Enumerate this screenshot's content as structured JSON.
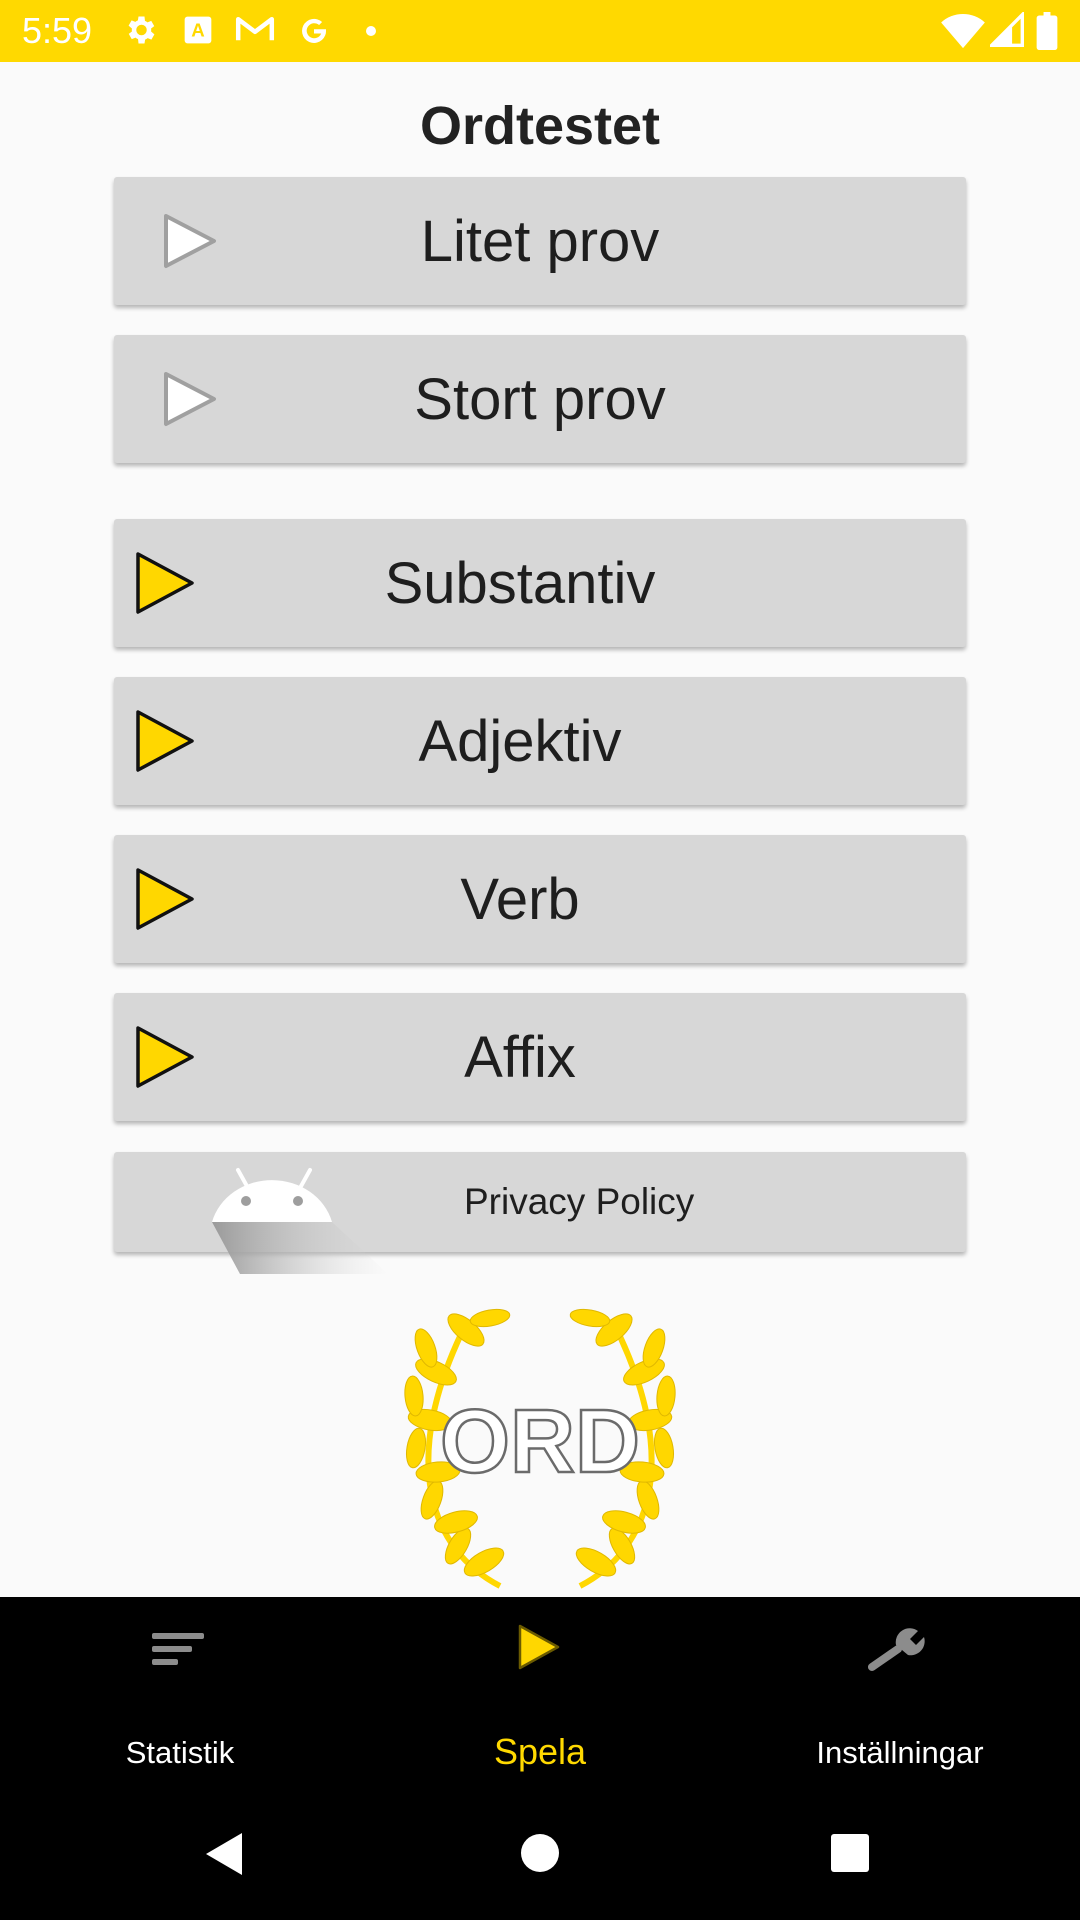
{
  "status_bar": {
    "time": "5:59",
    "left_icons": [
      "gear-icon",
      "a-box-icon",
      "gmail-icon",
      "google-icon",
      "dot-icon"
    ],
    "right_icons": [
      "wifi-icon",
      "cell-signal-icon",
      "battery-icon"
    ],
    "color": "#ffd900"
  },
  "title": "Ordtestet",
  "buttons": [
    {
      "label": "Litet prov",
      "icon": "play-outline-icon"
    },
    {
      "label": "Stort prov",
      "icon": "play-outline-icon"
    },
    {
      "label": "Substantiv",
      "icon": "play-yellow-icon"
    },
    {
      "label": "Adjektiv",
      "icon": "play-yellow-icon"
    },
    {
      "label": "Verb",
      "icon": "play-yellow-icon"
    },
    {
      "label": "Affix",
      "icon": "play-yellow-icon"
    }
  ],
  "privacy": {
    "label": "Privacy Policy",
    "icon": "android-icon"
  },
  "emblem": {
    "text": "ORD",
    "icon": "laurel-wreath-icon"
  },
  "bottom_nav": {
    "items": [
      {
        "label": "Statistik",
        "icon": "sort-lines-icon",
        "active": false
      },
      {
        "label": "Spela",
        "icon": "play-icon",
        "active": true
      },
      {
        "label": "Inställningar",
        "icon": "wrench-icon",
        "active": false
      }
    ],
    "active_color": "#ffd900"
  },
  "system_nav": {
    "icons": [
      "back-icon",
      "home-icon",
      "recents-icon"
    ]
  }
}
